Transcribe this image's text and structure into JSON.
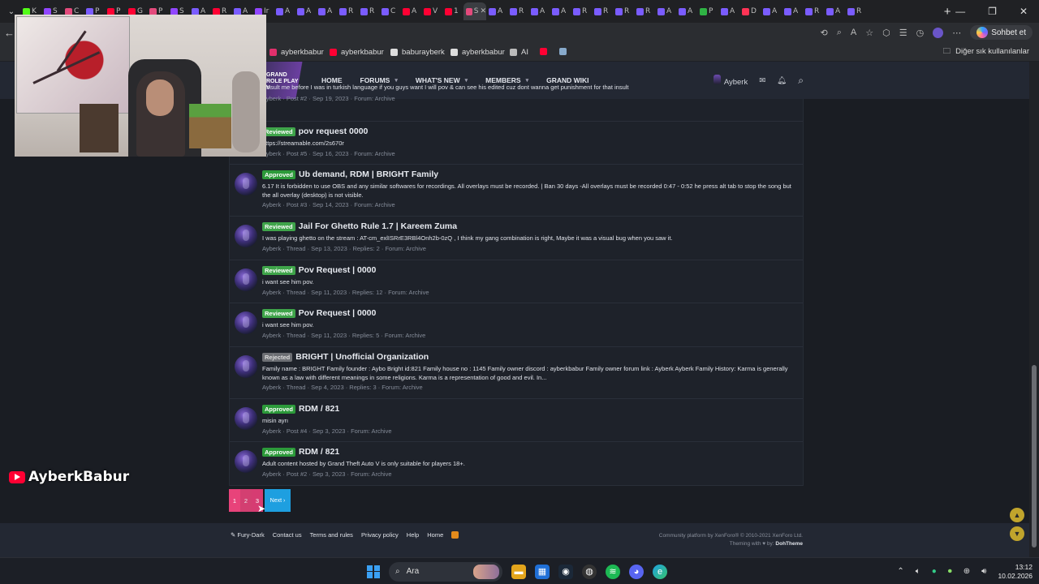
{
  "browser": {
    "tabs": [
      {
        "letter": "K",
        "color": "#53fc18"
      },
      {
        "letter": "S",
        "color": "#9146ff"
      },
      {
        "letter": "C",
        "color": "#e34a7c"
      },
      {
        "letter": "P",
        "color": "#7a5cff"
      },
      {
        "letter": "P",
        "color": "#ff0033"
      },
      {
        "letter": "G",
        "color": "#ff0033"
      },
      {
        "letter": "P",
        "color": "#e34a7c"
      },
      {
        "letter": "S",
        "color": "#9146ff"
      },
      {
        "letter": "A",
        "color": "#7a5cff"
      },
      {
        "letter": "R",
        "color": "#ff0033"
      },
      {
        "letter": "A",
        "color": "#7a5cff"
      },
      {
        "letter": "Ir",
        "color": "#9146ff"
      },
      {
        "letter": "A",
        "color": "#7a5cff"
      },
      {
        "letter": "A",
        "color": "#7a5cff"
      },
      {
        "letter": "A",
        "color": "#7a5cff"
      },
      {
        "letter": "R",
        "color": "#7a5cff"
      },
      {
        "letter": "R",
        "color": "#7a5cff"
      },
      {
        "letter": "C",
        "color": "#7a5cff"
      },
      {
        "letter": "A",
        "color": "#ff0033"
      },
      {
        "letter": "V",
        "color": "#ff0033"
      },
      {
        "letter": "1",
        "color": "#ff0033"
      },
      {
        "letter": "S",
        "color": "#e34a7c"
      },
      {
        "letter": "A",
        "color": "#7a5cff"
      },
      {
        "letter": "R",
        "color": "#7a5cff"
      },
      {
        "letter": "A",
        "color": "#7a5cff"
      },
      {
        "letter": "A",
        "color": "#7a5cff"
      },
      {
        "letter": "R",
        "color": "#7a5cff"
      },
      {
        "letter": "R",
        "color": "#7a5cff"
      },
      {
        "letter": "R",
        "color": "#7a5cff"
      },
      {
        "letter": "R",
        "color": "#7a5cff"
      },
      {
        "letter": "A",
        "color": "#7a5cff"
      },
      {
        "letter": "A",
        "color": "#7a5cff"
      },
      {
        "letter": "P",
        "color": "#2fb344"
      },
      {
        "letter": "A",
        "color": "#7a5cff"
      },
      {
        "letter": "D",
        "color": "#ff3355"
      },
      {
        "letter": "A",
        "color": "#7a5cff"
      },
      {
        "letter": "A",
        "color": "#7a5cff"
      },
      {
        "letter": "R",
        "color": "#7a5cff"
      },
      {
        "letter": "A",
        "color": "#7a5cff"
      },
      {
        "letter": "R",
        "color": "#7a5cff"
      }
    ],
    "active_tab_index": 21,
    "bookmarks": [
      {
        "label": "ayberkbabur",
        "icon": "instagram-icon",
        "color": "#e1306c"
      },
      {
        "label": "ayberkbabur",
        "icon": "youtube-icon",
        "color": "#ff0033"
      },
      {
        "label": "baburayberk",
        "icon": "x-icon",
        "color": "#dddddd"
      },
      {
        "label": "ayberkbabur",
        "icon": "tiktok-icon",
        "color": "#dddddd"
      },
      {
        "label": "AI",
        "icon": "ai-icon",
        "color": "#bbbbbb"
      },
      {
        "label": "",
        "icon": "youtube-icon",
        "color": "#ff0033"
      },
      {
        "label": "",
        "icon": "grid-icon",
        "color": "#88aacc"
      }
    ],
    "other_favorites": "Diğer sık kullanılanlar",
    "copilot_label": "Sohbet et"
  },
  "site": {
    "logo_lines": [
      "GRAND",
      "ROLE PLAY",
      "V"
    ],
    "nav": [
      {
        "label": "HOME",
        "dropdown": false
      },
      {
        "label": "FORUMS",
        "dropdown": true
      },
      {
        "label": "WHAT'S NEW",
        "dropdown": true
      },
      {
        "label": "MEMBERS",
        "dropdown": true
      },
      {
        "label": "GRAND WIKI",
        "dropdown": false
      }
    ],
    "username": "Ayberk"
  },
  "results": [
    {
      "badge": "",
      "badge_type": "",
      "title": "",
      "snippet": "I insult me before I was in turkish language if you guys want I will pov & can see his edited cuz dont wanna get punishment for that insult",
      "meta": "Ayberk · Post #2 · Sep 19, 2023 · Forum: Archive"
    },
    {
      "badge": "Reviewed",
      "badge_type": "reviewed",
      "title": "pov request 0000",
      "snippet": "https://streamable.com/2s670r",
      "meta": "Ayberk · Post #5 · Sep 16, 2023 · Forum: Archive"
    },
    {
      "badge": "Approved",
      "badge_type": "approved",
      "title": "Ub demand, RDM | BRIGHT Family",
      "snippet": "6.17 It is forbidden to use OBS and any similar softwares for recordings. All overlays must be recorded. | Ban 30 days -All overlays must be recorded 0:47 - 0:52 he press alt tab to stop the song but the all overlay (desktop) is not visible.",
      "meta": "Ayberk · Post #3 · Sep 14, 2023 · Forum: Archive"
    },
    {
      "badge": "Reviewed",
      "badge_type": "reviewed",
      "title": "Jail For Ghetto Rule 1.7 | Kareem Zuma",
      "snippet": "I was playing ghetto on the stream : AT-cm_exlISRrE3RBl4Onh2b-0zQ , I think my gang combination is right, Maybe it was a visual bug when you saw it.",
      "meta": "Ayberk · Thread · Sep 13, 2023 · Replies: 2 · Forum: Archive"
    },
    {
      "badge": "Reviewed",
      "badge_type": "reviewed",
      "title": "Pov Request | 0000",
      "snippet": "i want see him pov.",
      "meta": "Ayberk · Thread · Sep 11, 2023 · Replies: 12 · Forum: Archive"
    },
    {
      "badge": "Reviewed",
      "badge_type": "reviewed",
      "title": "Pov Request | 0000",
      "snippet": "i want see him pov.",
      "meta": "Ayberk · Thread · Sep 11, 2023 · Replies: 5 · Forum: Archive"
    },
    {
      "badge": "Rejected",
      "badge_type": "rejected",
      "title": "BRIGHT | Unofficial Organization",
      "snippet": "Family name : BRIGHT Family founder : Aybo Bright id:821 Family house no : 1145 Family owner discord : ayberkbabur Family owner forum link : Ayberk Ayberk Family History: Karma is generally known as a law with different meanings in some religions. Karma is a representation of good and evil. In...",
      "meta": "Ayberk · Thread · Sep 4, 2023 · Replies: 3 · Forum: Archive"
    },
    {
      "badge": "Approved",
      "badge_type": "approved",
      "title": "RDM / 821",
      "snippet": "misin ayrı",
      "meta": "Ayberk · Post #4 · Sep 3, 2023 · Forum: Archive"
    },
    {
      "badge": "Approved",
      "badge_type": "approved",
      "title": "RDM / 821",
      "snippet": "Adult content hosted by Grand Theft Auto V is only suitable for players 18+.",
      "meta": "Ayberk · Post #2 · Sep 3, 2023 · Forum: Archive"
    }
  ],
  "pagination": {
    "pages": [
      "1",
      "2",
      "3"
    ],
    "current": "3",
    "next": "Next ›"
  },
  "footer": {
    "style": "Fury-Dark",
    "links": [
      "Contact us",
      "Terms and rules",
      "Privacy policy",
      "Help",
      "Home"
    ],
    "copyright": "Community platform by XenForo® © 2010-2021 XenForo Ltd.",
    "theming_prefix": "Theming with",
    "theming_by": "by:",
    "theming_author": "DohTheme"
  },
  "overlay": {
    "channel_name": "AyberkBabur"
  },
  "taskbar": {
    "search_placeholder": "Ara",
    "time": "13:12",
    "date": "10.02.2026"
  }
}
